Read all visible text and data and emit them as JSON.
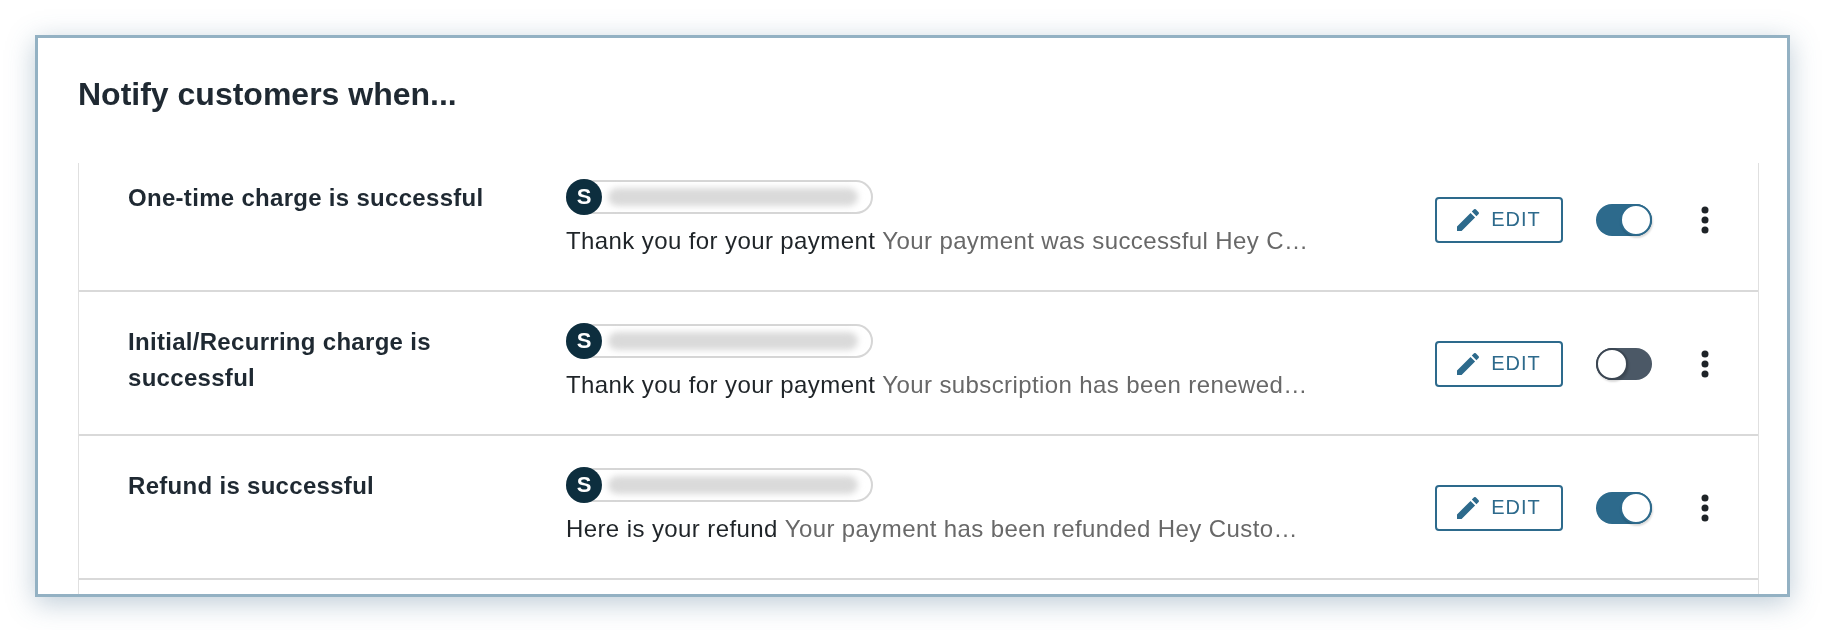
{
  "title": "Notify customers when...",
  "rows": [
    {
      "event": "One-time charge is successful",
      "sender_initial": "S",
      "subject": "Thank you for your payment",
      "preview": "Your payment was successful Hey C…",
      "edit_button": "EDIT",
      "on": true
    },
    {
      "event": "Initial/Recurring charge is successful",
      "sender_initial": "S",
      "subject": "Thank you for your payment",
      "preview": "Your subscription has been renewed…",
      "edit_button": "EDIT",
      "on": false
    },
    {
      "event": "Refund is successful",
      "sender_initial": "S",
      "subject": "Here is your refund",
      "preview": "Your payment has been refunded Hey Custo…",
      "edit_button": "EDIT",
      "on": true
    }
  ]
}
